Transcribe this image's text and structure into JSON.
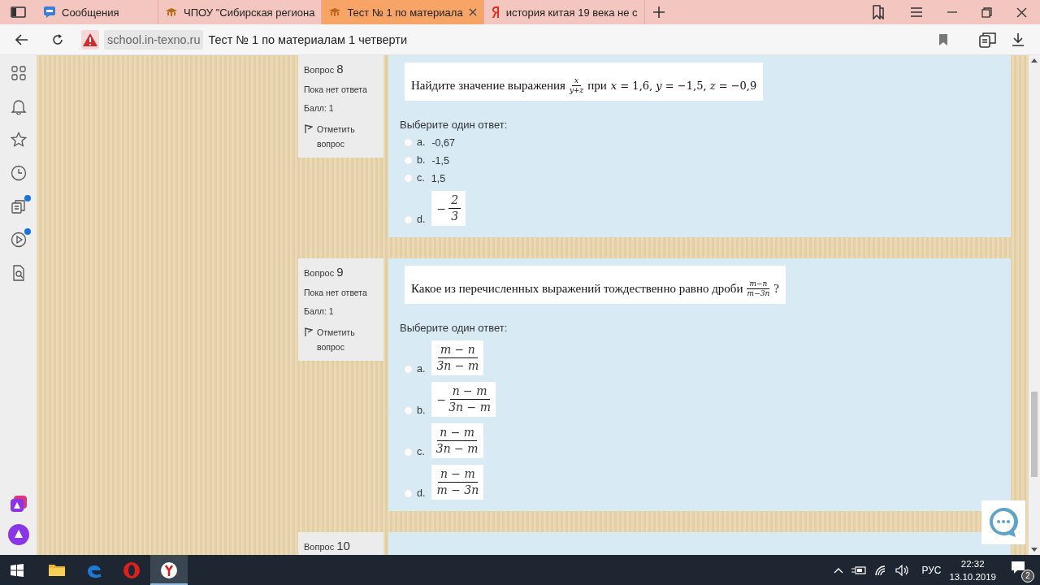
{
  "tabs": [
    {
      "kind": "messages",
      "label": "Сообщения",
      "selected": false
    },
    {
      "kind": "school",
      "label": "ЧПОУ \"Сибирская региона",
      "selected": false
    },
    {
      "kind": "school",
      "label": "Тест № 1 по материала",
      "selected": true
    },
    {
      "kind": "yandex",
      "label": "история китая 19 века не с",
      "selected": false
    }
  ],
  "address_bar": {
    "domain": "school.in-texno.ru",
    "title": "Тест № 1 по материалам 1 четверти"
  },
  "sidebar": {
    "items": [
      {
        "kind": "grid",
        "badge": false
      },
      {
        "kind": "bell",
        "badge": false
      },
      {
        "kind": "star",
        "badge": false
      },
      {
        "kind": "clock",
        "badge": false
      },
      {
        "kind": "collections",
        "badge": true
      },
      {
        "kind": "play",
        "badge": true
      },
      {
        "kind": "doc-search",
        "badge": false
      }
    ],
    "bottom_items": [
      {
        "kind": "alice-app"
      },
      {
        "kind": "alice"
      }
    ]
  },
  "questions": [
    {
      "label": "Вопрос",
      "number": "8",
      "status": "Пока нет ответа",
      "score": "Балл: 1",
      "flag": "Отметить вопрос",
      "prompt": [
        {
          "kind": "text",
          "text": "Найдите значение выражения"
        },
        {
          "kind": "fraction",
          "numerator": "x",
          "denominator": "y+z"
        },
        {
          "kind": "text",
          "text": "при"
        },
        {
          "kind": "math",
          "text": "*x* = 1,6, *y* = −1,5, *z* = −0,9"
        }
      ],
      "instruction": "Выберите один ответ:",
      "answers": [
        {
          "letter": "a.",
          "kind": "text",
          "text": "-0,67",
          "selected": false
        },
        {
          "letter": "b.",
          "kind": "text",
          "text": "-1,5",
          "selected": false
        },
        {
          "letter": "c.",
          "kind": "text",
          "text": "1,5",
          "selected": false
        },
        {
          "letter": "d.",
          "kind": "fraction",
          "sign": "−",
          "numerator": "2",
          "denominator": "3",
          "selected": false
        }
      ]
    },
    {
      "label": "Вопрос",
      "number": "9",
      "status": "Пока нет ответа",
      "score": "Балл: 1",
      "flag": "Отметить вопрос",
      "prompt": [
        {
          "kind": "text",
          "text": "Какое из перечисленных выражений тождественно равно дроби"
        },
        {
          "kind": "fraction",
          "numerator": "m−n",
          "denominator": "m−3n"
        },
        {
          "kind": "text",
          "text": "?"
        }
      ],
      "instruction": "Выберите один ответ:",
      "answers": [
        {
          "letter": "a.",
          "kind": "fraction",
          "numerator": "m − n",
          "denominator": "3n − m",
          "selected": false
        },
        {
          "letter": "b.",
          "kind": "fraction",
          "sign": "−",
          "numerator": "n − m",
          "denominator": "3n − m",
          "selected": false
        },
        {
          "letter": "c.",
          "kind": "fraction",
          "numerator": "n − m",
          "denominator": "3n − m",
          "selected": false
        },
        {
          "letter": "d.",
          "kind": "fraction",
          "numerator": "n − m",
          "denominator": "m − 3n",
          "selected": false
        }
      ]
    },
    {
      "label": "Вопрос",
      "number": "10"
    }
  ],
  "taskbar": {
    "apps": [
      {
        "kind": "folder",
        "active": false
      },
      {
        "kind": "edge",
        "active": false
      },
      {
        "kind": "opera",
        "active": false
      },
      {
        "kind": "yandex",
        "active": true
      }
    ],
    "language": "РУС",
    "time": "22:32",
    "date": "13.10.2019",
    "notifications": "2"
  }
}
